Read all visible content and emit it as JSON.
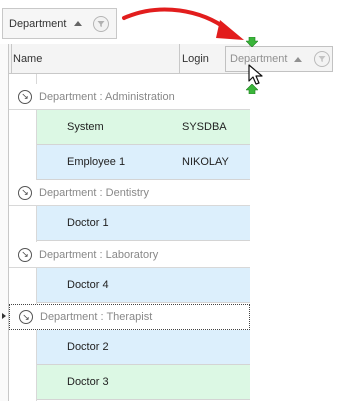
{
  "group_panel": {
    "chip_label": "Department",
    "sort_icon": "sort-ascending-icon",
    "filter_icon": "filter-icon"
  },
  "columns": {
    "name": "Name",
    "login": "Login"
  },
  "groups": [
    {
      "label": "Department : Administration",
      "rows": [
        {
          "name": "System",
          "login": "SYSDBA",
          "tint": "green"
        },
        {
          "name": "Employee 1",
          "login": "NIKOLAY",
          "tint": "blue"
        }
      ]
    },
    {
      "label": "Department : Dentistry",
      "rows": [
        {
          "name": "Doctor 1",
          "login": "",
          "tint": "blue"
        }
      ]
    },
    {
      "label": "Department : Laboratory",
      "rows": [
        {
          "name": "Doctor 4",
          "login": "",
          "tint": "blue"
        }
      ]
    },
    {
      "label": "Department : Therapist",
      "focused": true,
      "rows": [
        {
          "name": "Doctor 2",
          "login": "",
          "tint": "blue"
        },
        {
          "name": "Doctor 3",
          "login": "",
          "tint": "green"
        }
      ]
    }
  ],
  "drag_header": {
    "label": "Department"
  },
  "colors": {
    "arrow": "#e21d1d",
    "drop_marker": "#3ab53a",
    "row_green": "#dcf8e4",
    "row_blue": "#dceffc"
  }
}
